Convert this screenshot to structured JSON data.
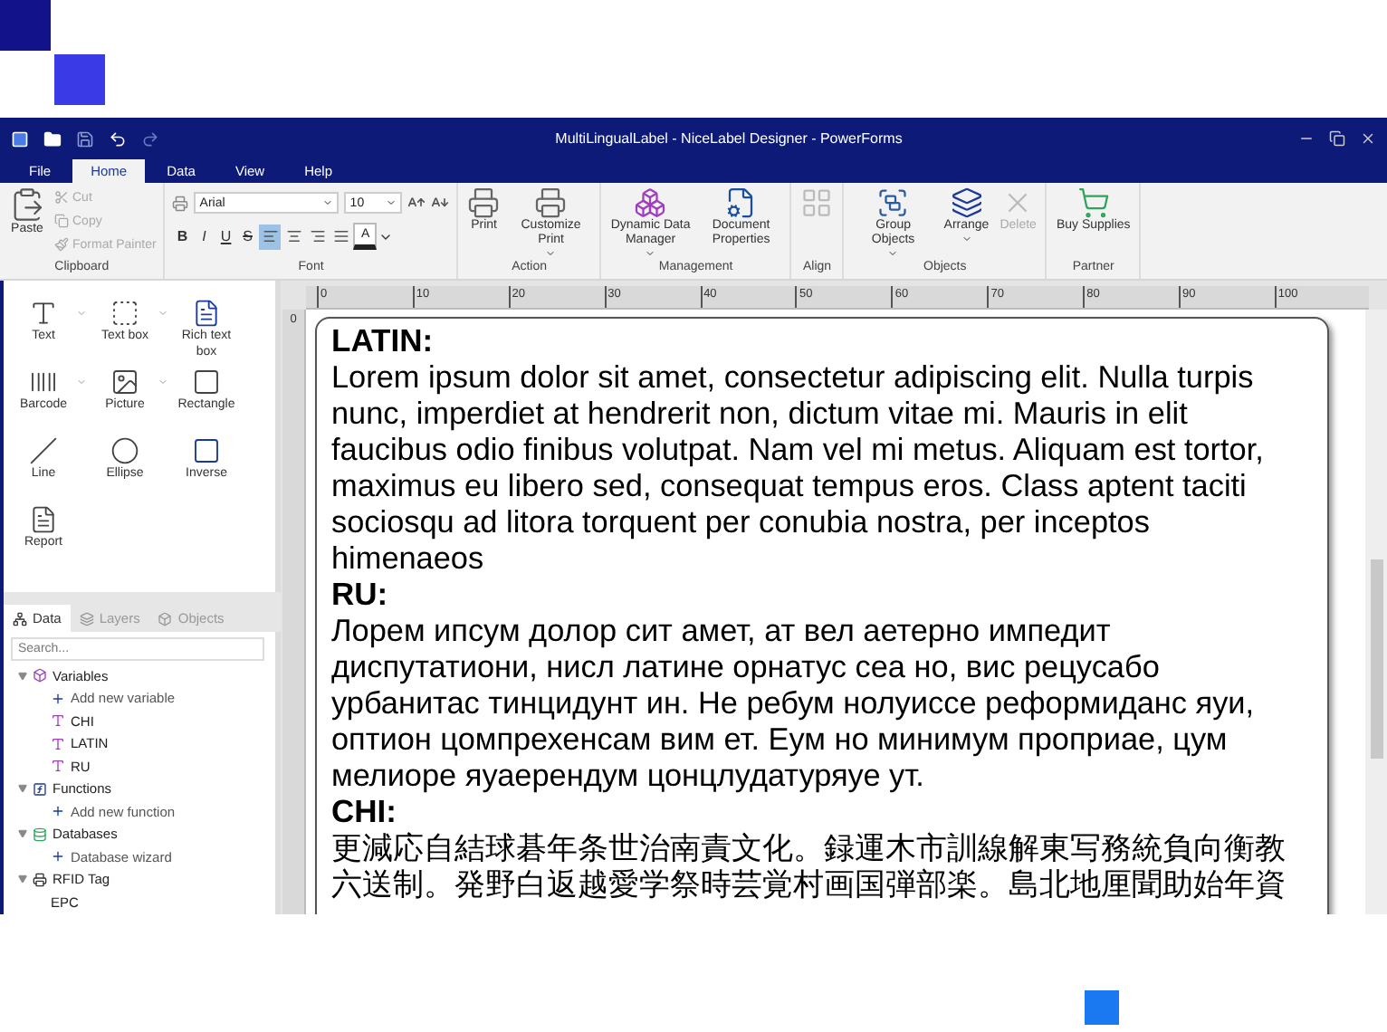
{
  "title_bar": {
    "title": "MultiLingualLabel - NiceLabel Designer - PowerForms"
  },
  "menu_tabs": [
    {
      "label": "File",
      "selected": false
    },
    {
      "label": "Home",
      "selected": true
    },
    {
      "label": "Data",
      "selected": false
    },
    {
      "label": "View",
      "selected": false
    },
    {
      "label": "Help",
      "selected": false
    }
  ],
  "clipboard": {
    "label": "Clipboard",
    "paste": "Paste",
    "small_buttons": [
      {
        "kind": "cut",
        "label": "Cut",
        "disabled": true
      },
      {
        "kind": "copy",
        "label": "Copy",
        "disabled": true
      },
      {
        "kind": "painter",
        "label": "Format Painter",
        "disabled": true
      }
    ]
  },
  "font": {
    "label": "Font",
    "font_name": "Arial",
    "font_size": "10",
    "styles": [
      {
        "label": "B",
        "kind": "bold"
      },
      {
        "label": "I",
        "kind": "italic"
      },
      {
        "label": "U",
        "kind": "underline"
      },
      {
        "label": "S",
        "kind": "strike"
      }
    ],
    "align_buttons": [
      {
        "kind": "left",
        "selected": true
      },
      {
        "kind": "center",
        "selected": false
      },
      {
        "kind": "right",
        "selected": false
      },
      {
        "kind": "justify",
        "selected": false
      }
    ],
    "color_label": "A"
  },
  "large_groups": [
    {
      "label": "Action",
      "buttons": [
        {
          "kind": "print",
          "label": "Print",
          "dropdown": false,
          "disabled": false
        },
        {
          "kind": "customize",
          "label": "Customize Print",
          "dropdown": true,
          "disabled": false
        }
      ]
    },
    {
      "label": "Management",
      "buttons": [
        {
          "kind": "data",
          "label": "Dynamic Data Manager",
          "dropdown": true,
          "disabled": false
        },
        {
          "kind": "docprops",
          "label": "Document Properties",
          "dropdown": false,
          "disabled": false
        }
      ]
    },
    {
      "label": "Align",
      "buttons": [
        {
          "kind": "align",
          "dropdown": false,
          "disabled": true
        }
      ]
    },
    {
      "label": "Objects",
      "buttons": [
        {
          "kind": "group",
          "label": "Group Objects",
          "dropdown": true,
          "disabled": false
        },
        {
          "kind": "arrange",
          "label": "Arrange",
          "dropdown": true,
          "disabled": false
        },
        {
          "kind": "delete",
          "label": "Delete",
          "dropdown": false,
          "disabled": true
        }
      ]
    },
    {
      "label": "Partner",
      "buttons": [
        {
          "kind": "cart",
          "label": "Buy Supplies",
          "dropdown": false,
          "disabled": false
        }
      ]
    }
  ],
  "toolbox": [
    {
      "kind": "text",
      "label": "Text",
      "has_dropdown": true
    },
    {
      "kind": "textbox",
      "label": "Text box",
      "has_dropdown": true
    },
    {
      "kind": "richtext",
      "label": "Rich text box",
      "has_dropdown": false
    },
    {
      "kind": "barcode",
      "label": "Barcode",
      "has_dropdown": true
    },
    {
      "kind": "picture",
      "label": "Picture",
      "has_dropdown": true
    },
    {
      "kind": "rectangle",
      "label": "Rectangle",
      "has_dropdown": false
    },
    {
      "kind": "line",
      "label": "Line",
      "has_dropdown": false
    },
    {
      "kind": "ellipse",
      "label": "Ellipse",
      "has_dropdown": false
    },
    {
      "kind": "inverse",
      "label": "Inverse",
      "has_dropdown": false
    },
    {
      "kind": "report",
      "label": "Report",
      "has_dropdown": false
    }
  ],
  "panel_tabs": [
    {
      "kind": "data",
      "label": "Data",
      "selected": true
    },
    {
      "kind": "layers",
      "label": "Layers",
      "selected": false
    },
    {
      "kind": "objects",
      "label": "Objects",
      "selected": false
    }
  ],
  "search": {
    "placeholder": "Search..."
  },
  "tree": [
    {
      "kind": "variables",
      "label": "Variables",
      "expanded": true,
      "children": [
        {
          "kind": "add",
          "label": "Add new variable"
        },
        {
          "kind": "variable",
          "label": "CHI"
        },
        {
          "kind": "variable",
          "label": "LATIN"
        },
        {
          "kind": "variable",
          "label": "RU"
        }
      ]
    },
    {
      "kind": "functions",
      "label": "Functions",
      "expanded": true,
      "children": [
        {
          "kind": "add",
          "label": "Add new function"
        }
      ]
    },
    {
      "kind": "databases",
      "label": "Databases",
      "expanded": true,
      "children": [
        {
          "kind": "add",
          "label": "Database wizard"
        }
      ]
    },
    {
      "kind": "rfid",
      "label": "RFID Tag",
      "expanded": true,
      "children": [
        {
          "kind": "field",
          "label": "EPC"
        }
      ]
    }
  ],
  "ruler": {
    "top_labels": [
      "0",
      "10",
      "20",
      "30",
      "40",
      "50",
      "60",
      "70",
      "80",
      "90",
      "100"
    ],
    "left_labels": [
      "0"
    ]
  },
  "label": {
    "sections": [
      {
        "heading": "LATIN:",
        "body": "Lorem ipsum dolor sit amet, consectetur adipiscing elit. Nulla turpis nunc, imperdiet at hendrerit non, dictum vitae mi. Mauris in elit faucibus odio finibus volutpat. Nam vel mi metus. Aliquam est tortor, maximus eu libero sed, consequat tempus eros. Class aptent taciti sociosqu ad litora torquent per conubia nostra, per inceptos himenaeos"
      },
      {
        "heading": "RU:",
        "body": "Лорем ипсум долор сит амет, ат вел аетерно импедит диспутатиони, нисл латине орнатус сеа но, вис рецусабо урбанитас тинцидунт ин. Не ребум нолуиссе реформиданс яуи, оптион цомпрехенсам вим ет. Еум но минимум проприае, цум мелиоре яуаерендум цонцлудатуряуе ут."
      },
      {
        "heading": "CHI:",
        "body": "更減応自結球碁年条世治南責文化。録運木市訓線解東写務統負向衡教六送制。発野白返越愛学祭時芸覚村画国弾部楽。島北地厘聞助始年資"
      }
    ]
  }
}
